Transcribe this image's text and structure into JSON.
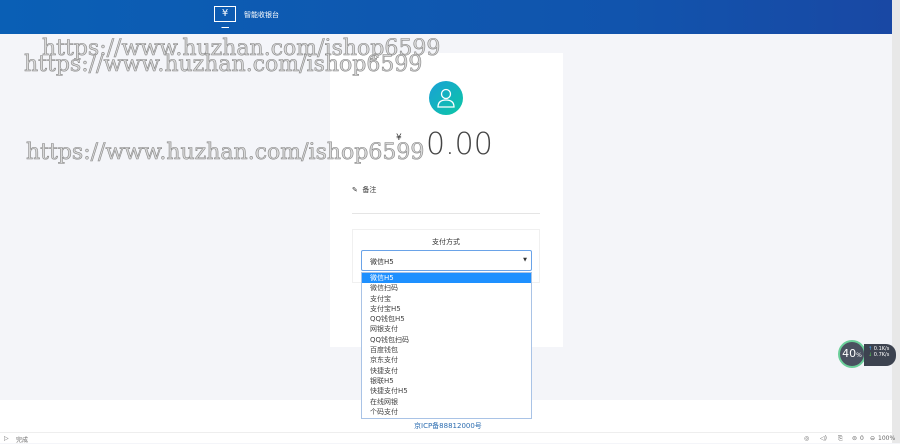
{
  "header": {
    "logo_icon": "yen-monitor-icon",
    "title": "智能收银台"
  },
  "watermark": "https://www.huzhan.com/ishop6599",
  "card": {
    "currency": "¥",
    "amount": "0.00",
    "note_label": "备注",
    "pay_method_label": "支付方式"
  },
  "select": {
    "value": "微信H5",
    "options": [
      "微信H5",
      "微信扫码",
      "支付宝",
      "支付宝H5",
      "QQ钱包H5",
      "网银支付",
      "QQ钱包扫码",
      "百度钱包",
      "京东支付",
      "快捷支付",
      "银联H5",
      "快捷支付H5",
      "在线网银",
      "个码支付"
    ],
    "selected_index": 0
  },
  "footer": {
    "icp": "京ICP备88812000号"
  },
  "status": {
    "left": "完成",
    "count": "0",
    "zoom": "100%"
  },
  "widget": {
    "cpu": "40",
    "cpu_unit": "%",
    "up": "0.1",
    "down": "0.7",
    "unit": "K/s"
  }
}
